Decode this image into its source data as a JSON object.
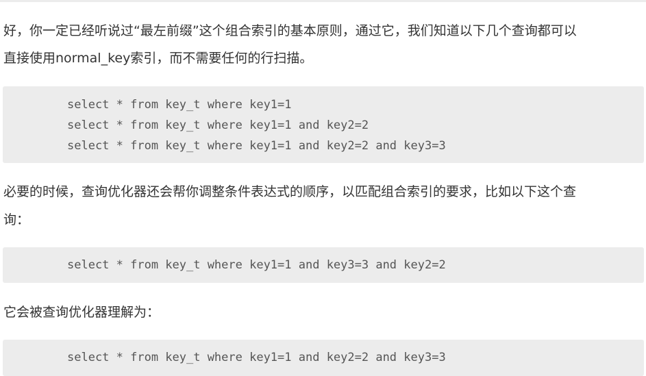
{
  "paragraphs": {
    "p1_line1": "好，你一定已经听说过“最左前缀”这个组合索引的基本原则，通过它，我们知道以下几个查询都可以",
    "p1_line2": "直接使用normal_key索引，而不需要任何的行扫描。",
    "p2_line1": "必要的时候，查询优化器还会帮你调整条件表达式的顺序，以匹配组合索引的要求，比如以下这个查",
    "p2_line2": "询：",
    "p3_line1": "它会被查询优化器理解为："
  },
  "code_blocks": [
    {
      "lines": [
        "select * from key_t where key1=1",
        "select * from key_t where key1=1 and key2=2",
        "select * from key_t where key1=1 and key2=2 and key3=3"
      ]
    },
    {
      "lines": [
        "select * from key_t where key1=1 and key3=3 and key2=2"
      ]
    },
    {
      "lines": [
        "select * from key_t where key1=1 and key2=2 and key3=3"
      ]
    }
  ]
}
